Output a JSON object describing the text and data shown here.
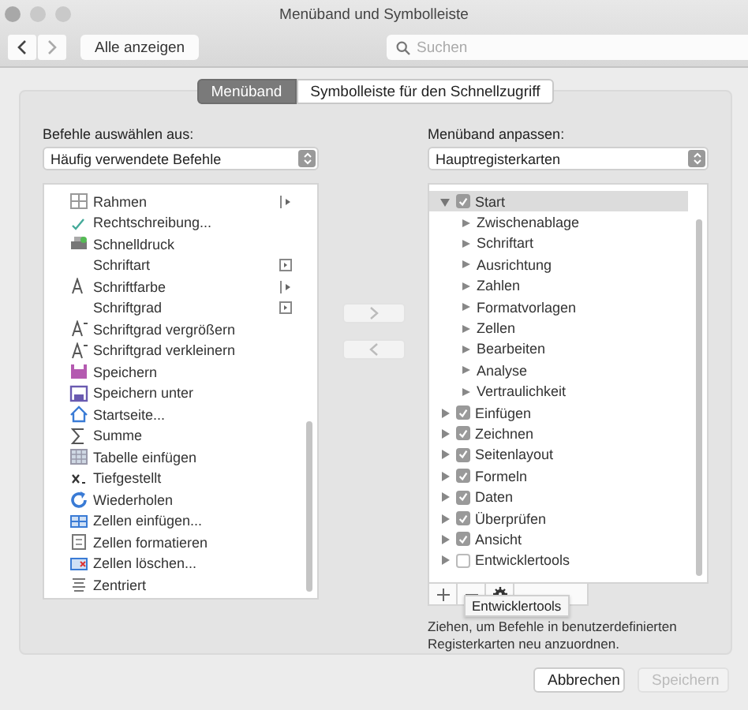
{
  "window": {
    "title": "Menüband und Symbolleiste"
  },
  "toolbar": {
    "show_all": "Alle anzeigen",
    "search": {
      "placeholder": "Suchen"
    }
  },
  "tabs": [
    {
      "label": "Menüband",
      "selected": true
    },
    {
      "label": "Symbolleiste für den Schnellzugriff",
      "selected": false
    }
  ],
  "left": {
    "label": "Befehle auswählen aus:",
    "dropdown": "Häufig verwendete Befehle",
    "commands": [
      {
        "label": "Rahmen",
        "kind": "submenu"
      },
      {
        "label": "Rechtschreibung...",
        "kind": "plain"
      },
      {
        "label": "Schnelldruck",
        "kind": "plain"
      },
      {
        "label": "Schriftart",
        "kind": "field"
      },
      {
        "label": "Schriftfarbe",
        "kind": "submenu"
      },
      {
        "label": "Schriftgrad",
        "kind": "field"
      },
      {
        "label": "Schriftgrad vergrößern",
        "kind": "plain"
      },
      {
        "label": "Schriftgrad verkleinern",
        "kind": "plain"
      },
      {
        "label": "Speichern",
        "kind": "plain"
      },
      {
        "label": "Speichern unter",
        "kind": "plain"
      },
      {
        "label": "Startseite...",
        "kind": "plain"
      },
      {
        "label": "Summe",
        "kind": "plain"
      },
      {
        "label": "Tabelle einfügen",
        "kind": "plain"
      },
      {
        "label": "Tiefgestellt",
        "kind": "plain"
      },
      {
        "label": "Wiederholen",
        "kind": "plain"
      },
      {
        "label": "Zellen einfügen...",
        "kind": "plain"
      },
      {
        "label": "Zellen formatieren",
        "kind": "plain"
      },
      {
        "label": "Zellen löschen...",
        "kind": "plain"
      },
      {
        "label": "Zentriert",
        "kind": "plain"
      }
    ]
  },
  "right": {
    "label": "Menüband anpassen:",
    "dropdown": "Hauptregisterkarten",
    "tabs": [
      {
        "label": "Start",
        "checked": true,
        "expanded": true,
        "selected": true,
        "children": [
          {
            "label": "Zwischenablage"
          },
          {
            "label": "Schriftart"
          },
          {
            "label": "Ausrichtung"
          },
          {
            "label": "Zahlen"
          },
          {
            "label": "Formatvorlagen"
          },
          {
            "label": "Zellen"
          },
          {
            "label": "Bearbeiten"
          },
          {
            "label": "Analyse"
          },
          {
            "label": "Vertraulichkeit"
          }
        ]
      },
      {
        "label": "Einfügen",
        "checked": true,
        "expanded": false,
        "selected": false
      },
      {
        "label": "Zeichnen",
        "checked": true,
        "expanded": false,
        "selected": false
      },
      {
        "label": "Seitenlayout",
        "checked": true,
        "expanded": false,
        "selected": false
      },
      {
        "label": "Formeln",
        "checked": true,
        "expanded": false,
        "selected": false
      },
      {
        "label": "Daten",
        "checked": true,
        "expanded": false,
        "selected": false
      },
      {
        "label": "Überprüfen",
        "checked": true,
        "expanded": false,
        "selected": false
      },
      {
        "label": "Ansicht",
        "checked": true,
        "expanded": false,
        "selected": false
      },
      {
        "label": "Entwicklertools",
        "checked": false,
        "expanded": false,
        "selected": false
      }
    ],
    "tooltip": "Entwicklertools",
    "hint": "Ziehen, um Befehle in benutzerdefinierten Registerkarten neu anzuordnen."
  },
  "buttons": [
    {
      "label": "Abbrechen",
      "disabled": false
    },
    {
      "label": "Speichern",
      "disabled": true
    }
  ]
}
